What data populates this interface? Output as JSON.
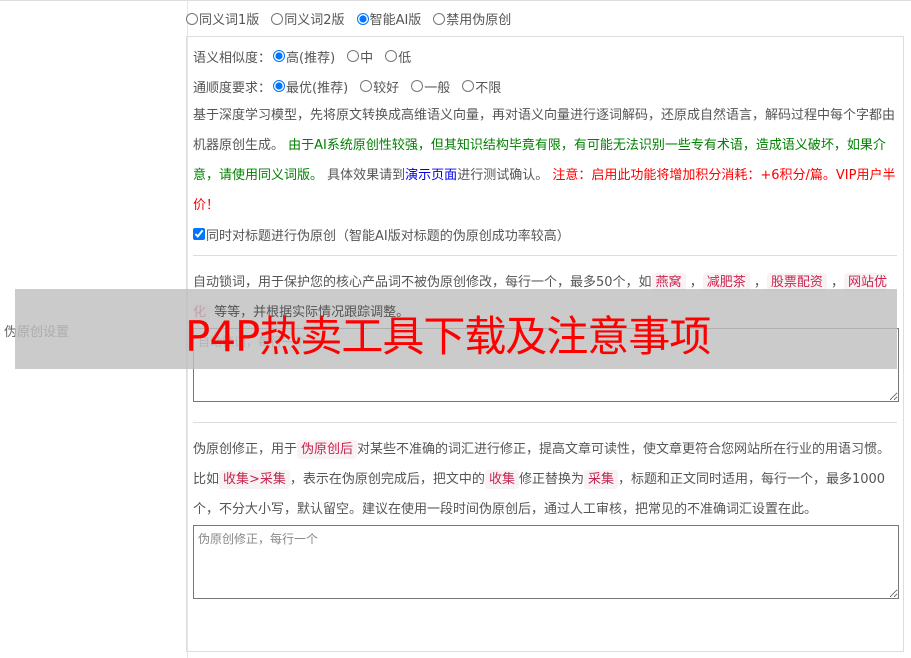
{
  "section_label": "伪原创设置",
  "modes": [
    "同义词1版",
    "同义词2版",
    "智能AI版",
    "禁用伪原创"
  ],
  "mode_selected": 2,
  "similarity": {
    "label": "语义相似度：",
    "options": [
      "高(推荐)",
      "中",
      "低"
    ],
    "selected": 0
  },
  "fluency": {
    "label": "通顺度要求：",
    "options": [
      "最优(推荐)",
      "较好",
      "一般",
      "不限"
    ],
    "selected": 0
  },
  "ai_desc": {
    "p1": "基于深度学习模型，先将原文转换成高维语义向量，再对语义向量进行逐词解码，还原成自然语言，解码过程中每个字都由机器原创生成。",
    "p2": "由于AI系统原创性较强，但其知识结构毕竟有限，有可能无法识别一些专有术语，造成语义破坏，如果介意，请使用同义词版。",
    "p3": "具体效果请到",
    "link": "演示页面",
    "p4": "进行测试确认。",
    "warn": "注意：启用此功能将增加积分消耗：+6积分/篇。VIP用户半价！"
  },
  "title_checkbox": {
    "label": "同时对标题进行伪原创（智能AI版对标题的伪原创成功率较高）",
    "checked": true
  },
  "lock": {
    "t1": "自动锁词，用于保护您的核心产品词不被伪原创修改，每行一个，最多50个，如",
    "tags": [
      "燕窝",
      "减肥茶",
      "股票配资",
      "网站优化"
    ],
    "t2": "等等，并根据实际情况跟踪调整。",
    "placeholder": "自动锁词，每行一个"
  },
  "fix": {
    "t1": "伪原创修正，用于",
    "c1": "伪原创后",
    "t2": "对某些不准确的词汇进行修正，提高文章可读性，使文章更符合您网站所在行业的用语习惯。比如",
    "c2": "收集>采集",
    "t3": "，表示在伪原创完成后，把文中的",
    "c3": "收集",
    "t4": "修正替换为",
    "c4": "采集",
    "t5": "，标题和正文同时适用，每行一个，最多1000个，不分大小写，默认留空。建议在使用一段时间伪原创后，通过人工审核，把常见的不准确词汇设置在此。",
    "placeholder": "伪原创修正，每行一个"
  },
  "overlay_title": "P4P热卖工具下载及注意事项"
}
